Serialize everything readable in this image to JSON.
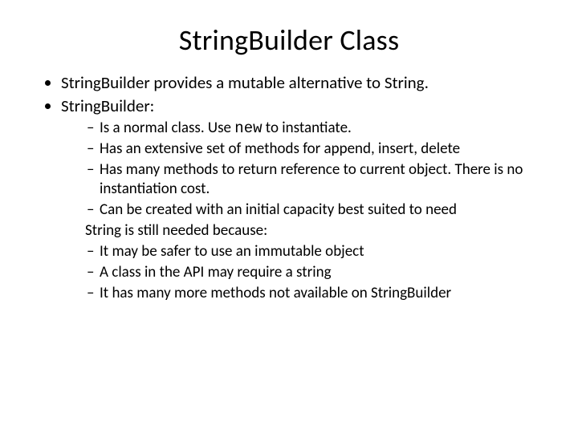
{
  "title": "StringBuilder Class",
  "bullets": {
    "b1_a": "StringBuilder",
    "b1_b": " provides a mutable alternative to ",
    "b1_c": "String.",
    "b2": "StringBuilder:",
    "b2s1_a": "Is a normal class. Use ",
    "b2s1_b": "new",
    "b2s1_c": " to instantiate.",
    "b2s2": "Has an extensive set of methods for append, insert, delete",
    "b2s3": "Has many methods to return reference to current object. There is no instantiation cost.",
    "b2s4": "Can be created with an initial capacity best suited to need",
    "sub": "String is still needed because:",
    "s3s1": "It may be safer to use an immutable object",
    "s3s2": "A class in the API may require a string",
    "s3s3": "It has many more methods not available on StringBuilder"
  }
}
